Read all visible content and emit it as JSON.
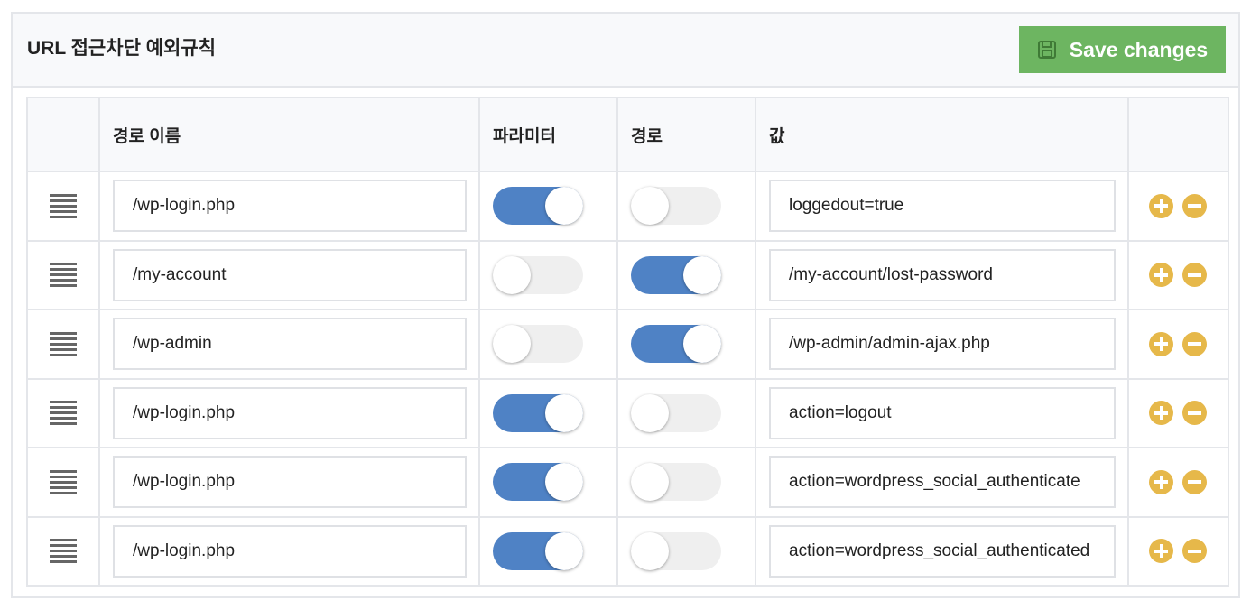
{
  "panel": {
    "title": "URL 접근차단 예외규칙",
    "save_label": "Save changes"
  },
  "table": {
    "headers": {
      "handle": "",
      "name": "경로 이름",
      "parameter": "파라미터",
      "path": "경로",
      "value": "값",
      "actions": ""
    },
    "rows": [
      {
        "name": "/wp-login.php",
        "parameter_on": true,
        "path_on": false,
        "value": "loggedout=true"
      },
      {
        "name": "/my-account",
        "parameter_on": false,
        "path_on": true,
        "value": "/my-account/lost-password"
      },
      {
        "name": "/wp-admin",
        "parameter_on": false,
        "path_on": true,
        "value": "/wp-admin/admin-ajax.php"
      },
      {
        "name": "/wp-login.php",
        "parameter_on": true,
        "path_on": false,
        "value": "action=logout"
      },
      {
        "name": "/wp-login.php",
        "parameter_on": true,
        "path_on": false,
        "value": "action=wordpress_social_authenticate"
      },
      {
        "name": "/wp-login.php",
        "parameter_on": true,
        "path_on": false,
        "value": "action=wordpress_social_authenticated"
      }
    ]
  },
  "colors": {
    "save_button": "#6db561",
    "toggle_on": "#4f82c5",
    "toggle_off": "#efefef",
    "action_icon": "#e6b84a"
  },
  "icons": {
    "save": "floppy-disk-icon",
    "handle": "drag-handle-icon",
    "add": "plus-circle-icon",
    "remove": "minus-circle-icon"
  }
}
